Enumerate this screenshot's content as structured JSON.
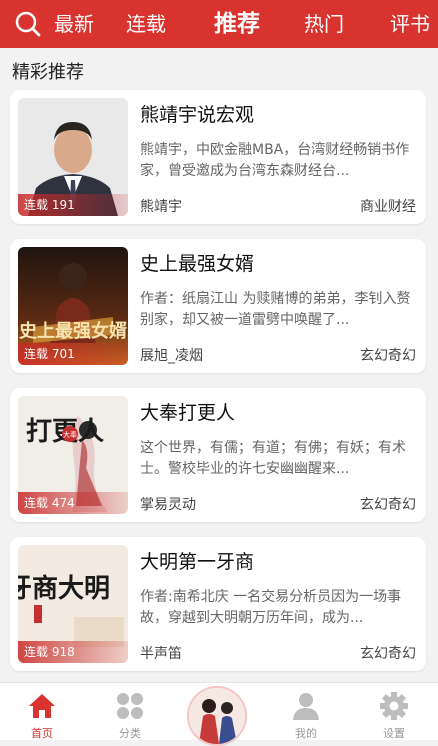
{
  "header": {
    "tabs": [
      {
        "label": "最新",
        "active": false
      },
      {
        "label": "连载",
        "active": false
      },
      {
        "label": "推荐",
        "active": true
      },
      {
        "label": "热门",
        "active": false
      },
      {
        "label": "评书",
        "active": false
      }
    ]
  },
  "section": {
    "title": "精彩推荐"
  },
  "books": [
    {
      "title": "熊靖宇说宏观",
      "desc": "熊靖宇，中欧金融MBA，台湾财经畅销书作家，曾受邀成为台湾东森财经台...",
      "author": "熊靖宇",
      "category": "商业财经",
      "badge": "连载 191"
    },
    {
      "title": "史上最强女婿",
      "desc": "作者：纸扇江山 为赎赌博的弟弟，李钊入赘别家，却又被一道雷劈中唤醒了...",
      "author": "展旭_凌烟",
      "category": "玄幻奇幻",
      "badge": "连载 701",
      "cover_text": "史上最强女婿"
    },
    {
      "title": "大奉打更人",
      "desc": "这个世界，有儒；有道；有佛；有妖；有术士。警校毕业的许七安幽幽醒来...",
      "author": "掌易灵动",
      "category": "玄幻奇幻",
      "badge": "连载 474",
      "cover_text": "打更人",
      "cover_seal": "大奉"
    },
    {
      "title": "大明第一牙商",
      "desc": "作者:南希北庆 一名交易分析员因为一场事故，穿越到大明朝万历年间，成为...",
      "author": "半声笛",
      "category": "玄幻奇幻",
      "badge": "连载 918",
      "cover_text": "牙商大明"
    }
  ],
  "bottom_nav": [
    {
      "label": "首页",
      "icon": "home-icon",
      "active": true
    },
    {
      "label": "分类",
      "icon": "category-icon",
      "active": false
    },
    {
      "label": "我的",
      "icon": "user-icon",
      "active": false
    },
    {
      "label": "设置",
      "icon": "settings-icon",
      "active": false
    }
  ],
  "colors": {
    "brand": "#d8332f",
    "text": "#111111",
    "muted": "#666666"
  }
}
